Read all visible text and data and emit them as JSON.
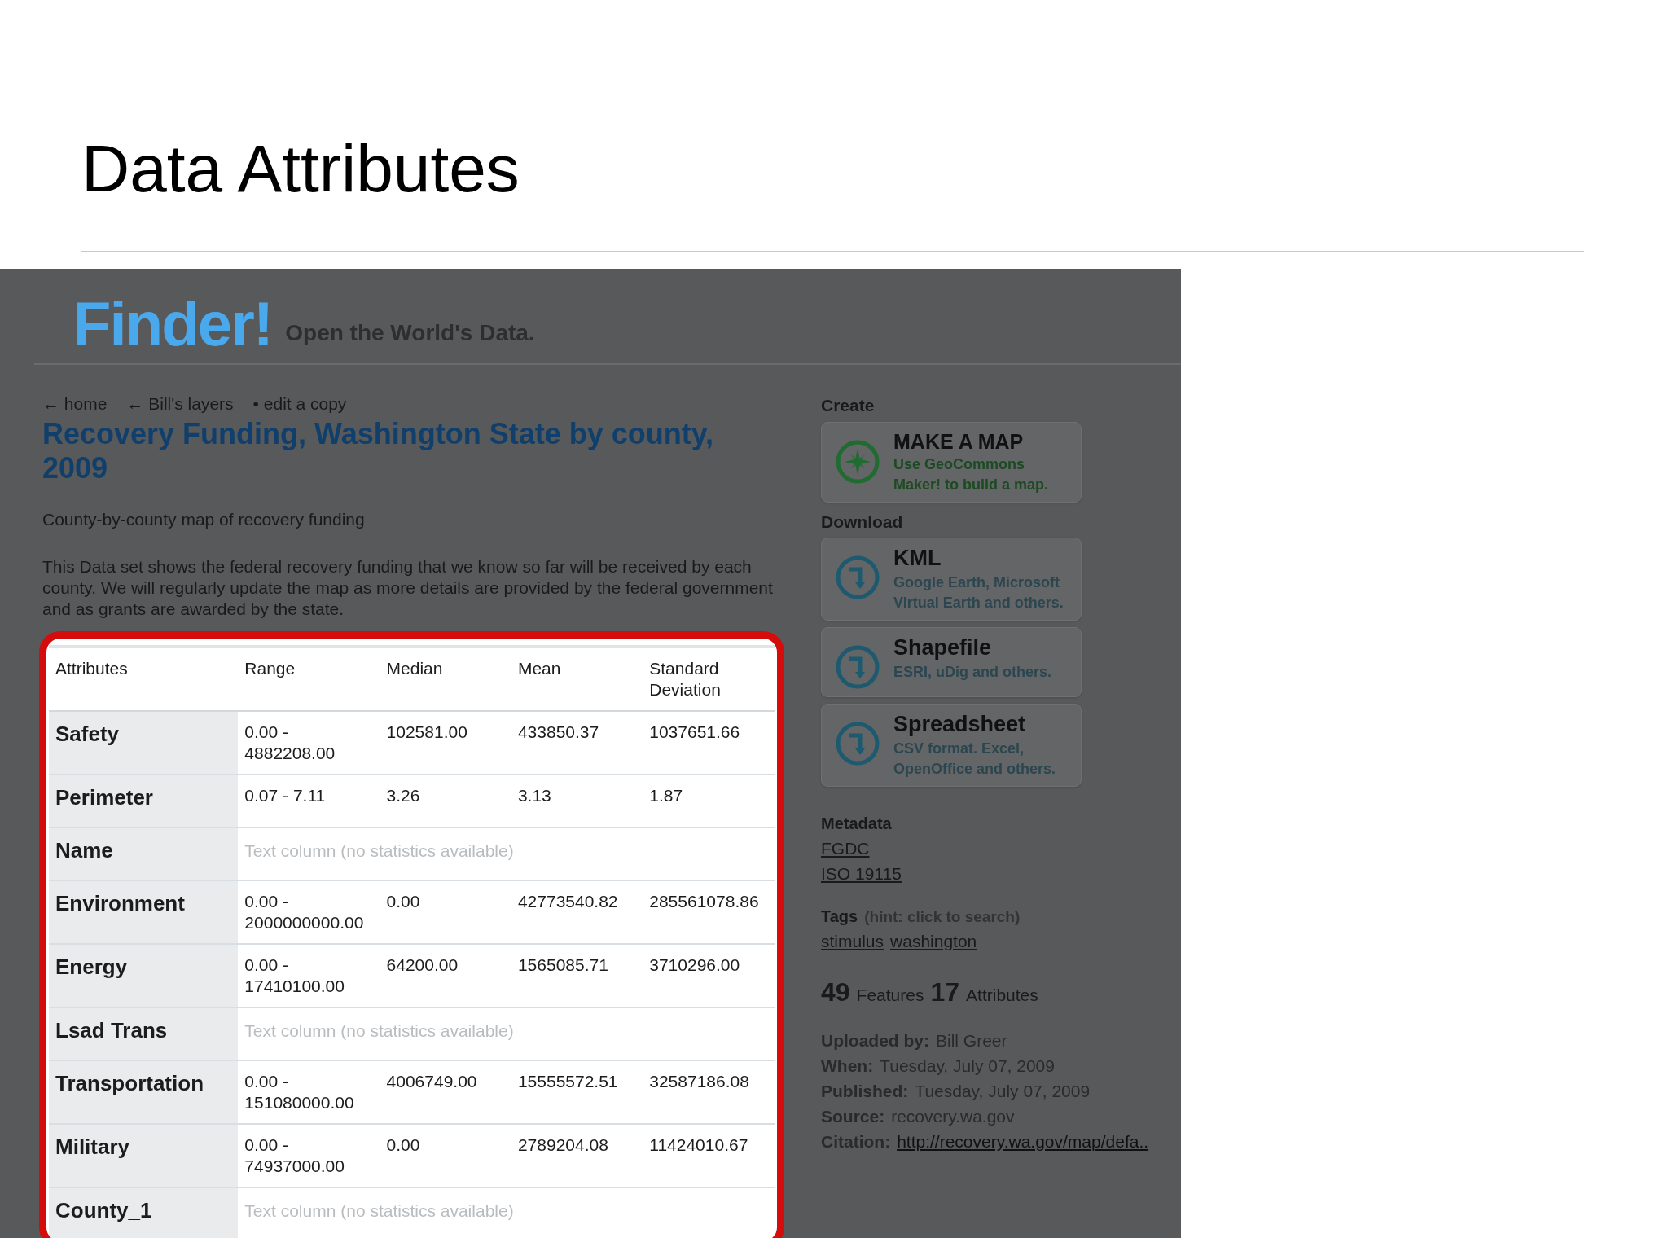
{
  "slide_title": "Data Attributes",
  "page": {
    "logo": "Finder!",
    "tagline": "Open the World's Data.",
    "breadcrumbs": [
      {
        "arrow": "←",
        "label": "home"
      },
      {
        "arrow": "←",
        "label": "Bill's layers"
      },
      {
        "arrow": "•",
        "label": "edit a copy"
      }
    ],
    "title": "Recovery Funding, Washington State by county, 2009",
    "subtitle": "County-by-county map of recovery funding",
    "description": "This Data set shows the federal recovery funding that we know so far will be received by each county. We will regularly update the map as more details are provided by the federal government and as grants are awarded by the state.",
    "table": {
      "columns": [
        "Attributes",
        "Range",
        "Median",
        "Mean",
        "Standard Deviation"
      ],
      "rows": [
        {
          "kind": "numeric",
          "name": "Safety",
          "cells": [
            "0.00 - 4882208.00",
            "102581.00",
            "433850.37",
            "1037651.66"
          ]
        },
        {
          "kind": "numeric",
          "name": "Perimeter",
          "cells": [
            "0.07 - 7.11",
            "3.26",
            "3.13",
            "1.87"
          ]
        },
        {
          "kind": "text",
          "name": "Name",
          "note": "Text column (no statistics available)"
        },
        {
          "kind": "numeric",
          "name": "Environment",
          "cells": [
            "0.00 - 2000000000.00",
            "0.00",
            "42773540.82",
            "285561078.86"
          ]
        },
        {
          "kind": "numeric",
          "name": "Energy",
          "cells": [
            "0.00 - 17410100.00",
            "64200.00",
            "1565085.71",
            "3710296.00"
          ]
        },
        {
          "kind": "text",
          "name": "Lsad Trans",
          "note": "Text column (no statistics available)"
        },
        {
          "kind": "numeric",
          "name": "Transportation",
          "cells": [
            "0.00 - 151080000.00",
            "4006749.00",
            "15555572.51",
            "32587186.08"
          ]
        },
        {
          "kind": "numeric",
          "name": "Military",
          "cells": [
            "0.00 - 74937000.00",
            "0.00",
            "2789204.08",
            "11424010.67"
          ]
        },
        {
          "kind": "text",
          "name": "County_1",
          "note": "Text column (no statistics available)"
        }
      ]
    }
  },
  "sidebar": {
    "create_heading": "Create",
    "create_card": {
      "kind": "map",
      "title": "MAKE A MAP",
      "text": "Use GeoCommons Maker! to build a map."
    },
    "download_heading": "Download",
    "download_cards": [
      {
        "kind": "download",
        "title": "KML",
        "text": "Google Earth, Microsoft Virtual Earth and others."
      },
      {
        "kind": "download",
        "title": "Shapefile",
        "text": "ESRI, uDig and others."
      },
      {
        "kind": "download",
        "title": "Spreadsheet",
        "text": "CSV format. Excel, OpenOffice and others."
      }
    ],
    "metadata_heading": "Metadata",
    "metadata_links": [
      "FGDC",
      "ISO 19115"
    ],
    "tags_heading": "Tags",
    "tags_hint": "(hint: click to search)",
    "tags": [
      "stimulus",
      "washington"
    ],
    "counts": [
      {
        "number": "49",
        "label": "Features"
      },
      {
        "number": "17",
        "label": "Attributes"
      }
    ],
    "info": [
      {
        "label": "Uploaded by:",
        "value": "Bill Greer"
      },
      {
        "label": "When:",
        "value": "Tuesday, July 07, 2009"
      },
      {
        "label": "Published:",
        "value": "Tuesday, July 07, 2009"
      },
      {
        "label": "Source:",
        "value": "recovery.wa.gov"
      },
      {
        "label": "Citation:",
        "value": "http://recovery.wa.gov/map/defa..",
        "link": true
      }
    ]
  }
}
